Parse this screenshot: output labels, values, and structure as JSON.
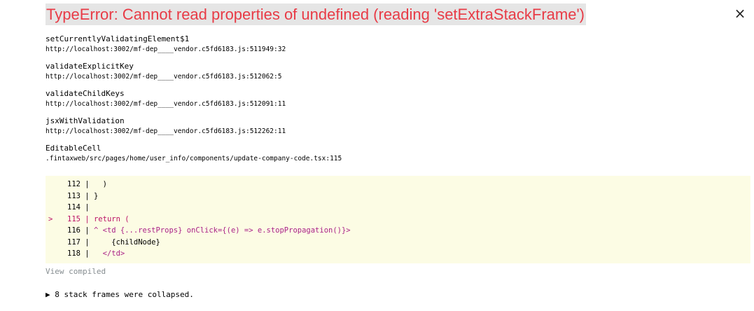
{
  "error": {
    "title": "TypeError: Cannot read properties of undefined (reading 'setExtraStackFrame')",
    "close_icon": "×"
  },
  "frames": [
    {
      "function": "setCurrentlyValidatingElement$1",
      "location": "http://localhost:3002/mf-dep____vendor.c5fd6183.js:511949:32"
    },
    {
      "function": "validateExplicitKey",
      "location": "http://localhost:3002/mf-dep____vendor.c5fd6183.js:512062:5"
    },
    {
      "function": "validateChildKeys",
      "location": "http://localhost:3002/mf-dep____vendor.c5fd6183.js:512091:11"
    },
    {
      "function": "jsxWithValidation",
      "location": "http://localhost:3002/mf-dep____vendor.c5fd6183.js:512262:11"
    },
    {
      "function": "EditableCell",
      "location": ".fintaxweb/src/pages/home/user_info/components/update-company-code.tsx:115"
    }
  ],
  "code": {
    "lines": [
      {
        "marker": "",
        "number": "112",
        "text": "   )"
      },
      {
        "marker": "",
        "number": "113",
        "text": " }"
      },
      {
        "marker": "",
        "number": "114",
        "text": ""
      },
      {
        "marker": ">",
        "number": "115",
        "text": " return ("
      },
      {
        "marker": "",
        "number": "116",
        "text": " ^ <td {...restProps} onClick={(e) => e.stopPropagation()}>"
      },
      {
        "marker": "",
        "number": "117",
        "text": "     {childNode}"
      },
      {
        "marker": "",
        "number": "118",
        "text": "   </td>"
      }
    ]
  },
  "view_compiled": "View compiled",
  "collapsed_text": "▶ 8 stack frames were collapsed.",
  "colors": {
    "error_text": "#e83b46",
    "error_bg": "#e5e5e5",
    "code_bg": "#fcfce4",
    "keyword": "#bb1166",
    "muted": "#878e91"
  }
}
